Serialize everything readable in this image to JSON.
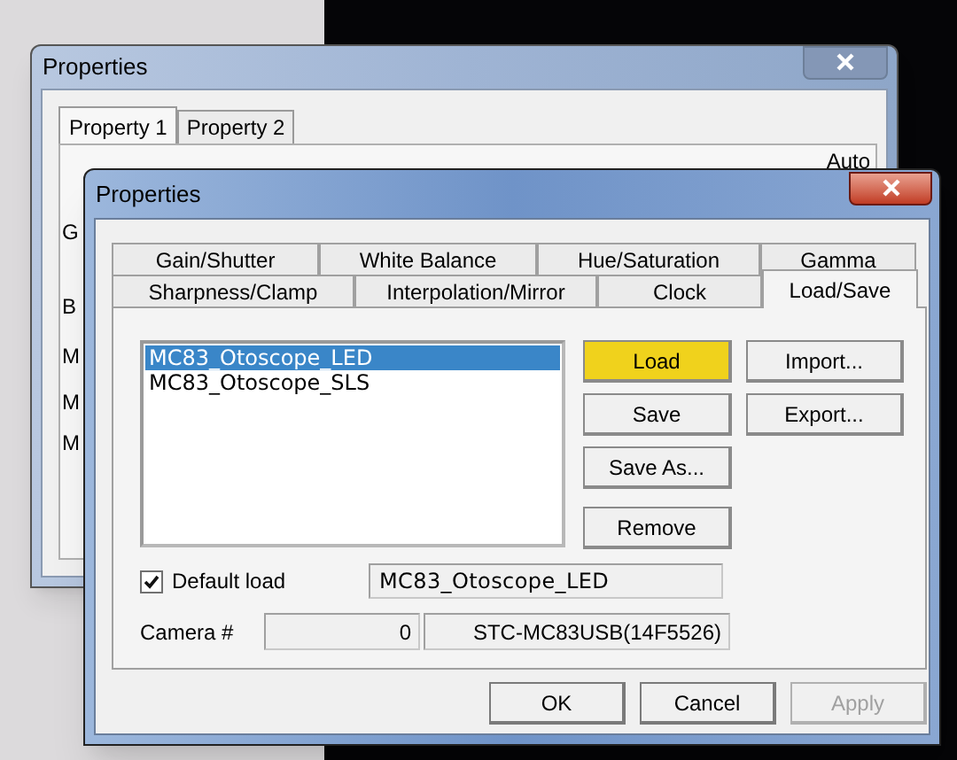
{
  "back_window": {
    "title": "Properties",
    "tabs": [
      {
        "label": "Property 1",
        "selected": true
      },
      {
        "label": "Property 2",
        "selected": false
      }
    ],
    "auto_label": "Auto",
    "partial_labels": [
      "G",
      "B",
      "M",
      "M",
      "M"
    ]
  },
  "window": {
    "title": "Properties",
    "tab_rows": [
      [
        {
          "label": "Gain/Shutter",
          "selected": false
        },
        {
          "label": "White Balance",
          "selected": false
        },
        {
          "label": "Hue/Saturation",
          "selected": false
        },
        {
          "label": "Gamma",
          "selected": false
        }
      ],
      [
        {
          "label": "Sharpness/Clamp",
          "selected": false
        },
        {
          "label": "Interpolation/Mirror",
          "selected": false
        },
        {
          "label": "Clock",
          "selected": false
        },
        {
          "label": "Load/Save",
          "selected": true
        }
      ]
    ],
    "list": [
      {
        "label": "MC83_Otoscope_LED",
        "selected": true
      },
      {
        "label": "MC83_Otoscope_SLS",
        "selected": false
      }
    ],
    "buttons": [
      {
        "label": "Load",
        "highlighted": true
      },
      {
        "label": "Save",
        "highlighted": false
      },
      {
        "label": "Save As...",
        "highlighted": false
      },
      {
        "label": "Remove",
        "highlighted": false
      }
    ],
    "side_buttons": [
      {
        "label": "Import..."
      },
      {
        "label": "Export..."
      }
    ],
    "default_load": {
      "label": "Default load",
      "checked": true,
      "value": "MC83_Otoscope_LED"
    },
    "camera": {
      "label": "Camera #",
      "number": "0",
      "model": "STC-MC83USB(14F5526)"
    },
    "footer_buttons": [
      {
        "label": "OK",
        "disabled": false
      },
      {
        "label": "Cancel",
        "disabled": false
      },
      {
        "label": "Apply",
        "disabled": true
      }
    ]
  }
}
